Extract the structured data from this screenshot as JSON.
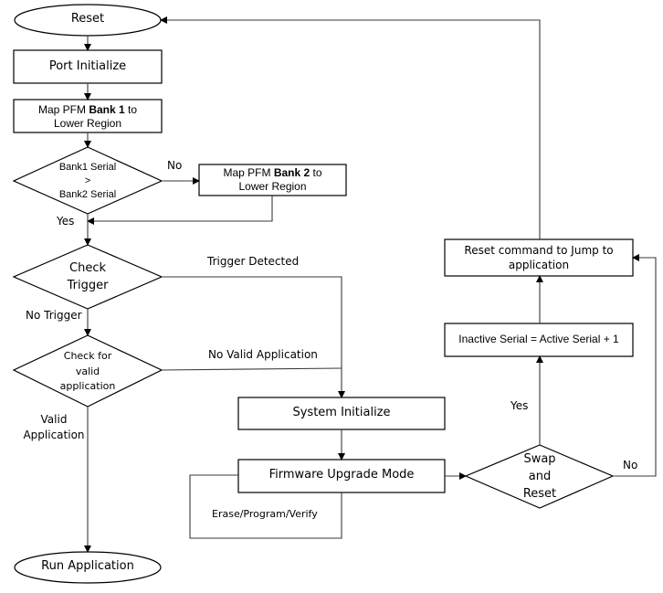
{
  "diagram": {
    "nodes": {
      "reset": {
        "label": "Reset",
        "shape": "terminal"
      },
      "port_initialize": {
        "label": "Port Initialize",
        "shape": "process"
      },
      "map_bank1": {
        "prefix": "Map PFM ",
        "bold": "Bank 1",
        "suffix": " to",
        "line2": "Lower Region",
        "shape": "process"
      },
      "bank_compare": {
        "line1": "Bank1 Serial",
        "line2": ">",
        "line3": "Bank2 Serial",
        "shape": "decision"
      },
      "map_bank2": {
        "prefix": "Map PFM ",
        "bold": "Bank 2",
        "suffix": " to",
        "line2": "Lower Region",
        "shape": "process"
      },
      "check_trigger": {
        "line1": "Check",
        "line2": "Trigger",
        "shape": "decision"
      },
      "check_valid_app": {
        "line1": "Check for",
        "line2": "valid",
        "line3": "application",
        "shape": "decision"
      },
      "run_application": {
        "label": "Run Application",
        "shape": "terminal"
      },
      "system_initialize": {
        "label": "System Initialize",
        "shape": "process"
      },
      "firmware_upgrade": {
        "label": "Firmware Upgrade Mode",
        "shape": "process"
      },
      "erase_program_verify": {
        "label": "Erase/Program/Verify"
      },
      "swap_and_reset": {
        "line1": "Swap",
        "line2": "and",
        "line3": "Reset",
        "shape": "decision"
      },
      "inactive_serial": {
        "label": "Inactive Serial = Active  Serial + 1",
        "shape": "process"
      },
      "reset_command": {
        "line1": "Reset command to Jump to",
        "line2": "application",
        "shape": "process"
      }
    },
    "edge_labels": {
      "bank_no": "No",
      "bank_yes": "Yes",
      "trigger_detected": "Trigger Detected",
      "no_trigger": "No Trigger",
      "no_valid_app": "No Valid Application",
      "valid_app_line1": "Valid",
      "valid_app_line2": "Application",
      "swap_yes": "Yes",
      "swap_no": "No"
    }
  }
}
